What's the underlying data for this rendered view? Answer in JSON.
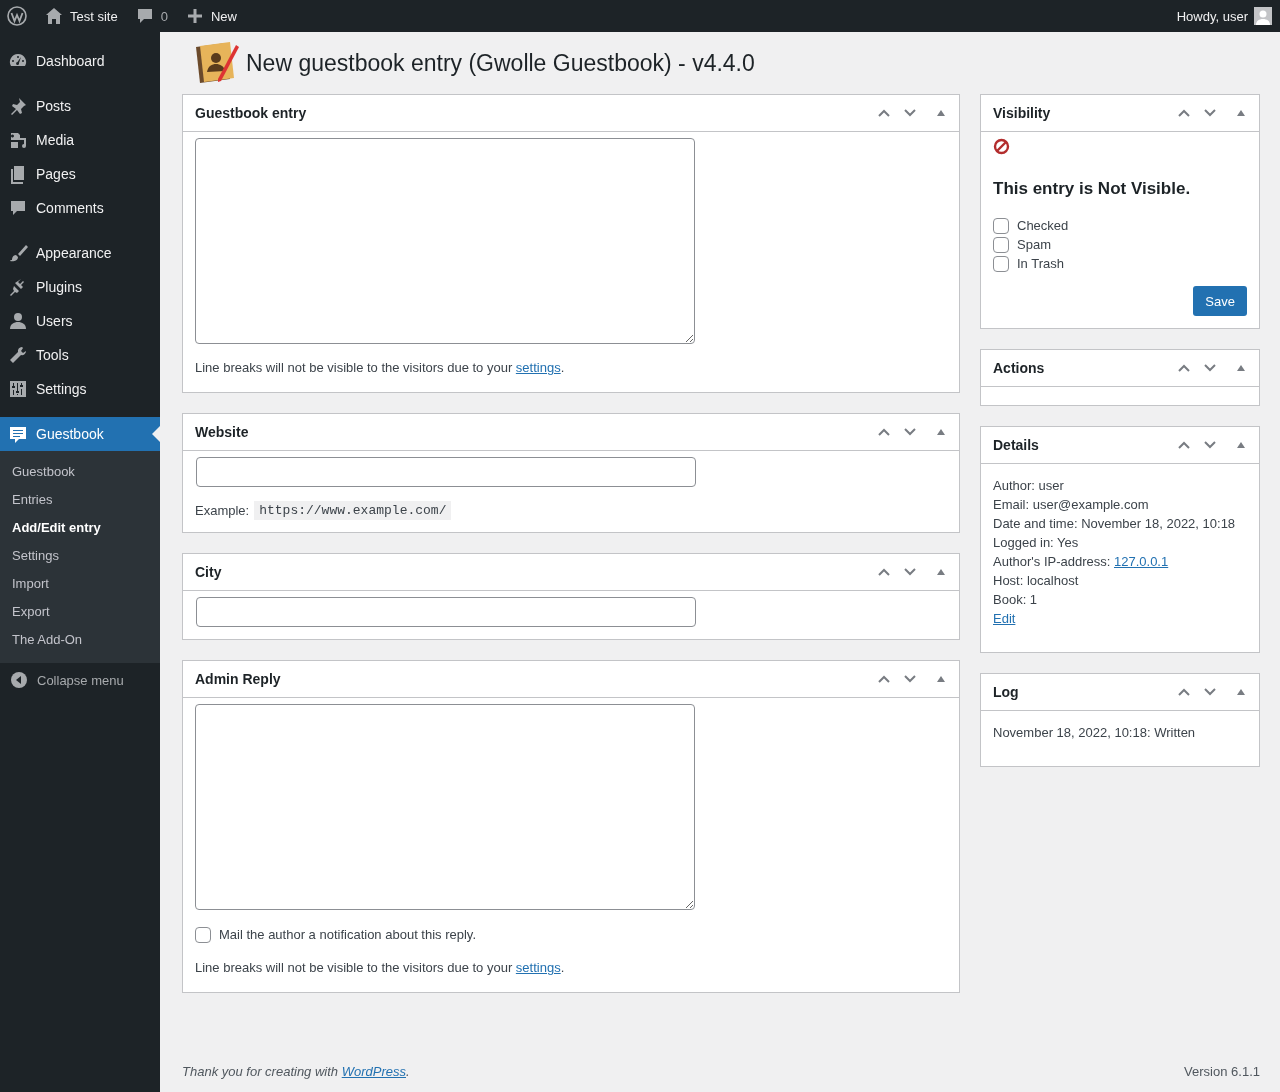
{
  "admin_bar": {
    "site": "Test site",
    "comments": "0",
    "new": "New",
    "greeting": "Howdy, user"
  },
  "menu_groups": [
    {
      "items": [
        {
          "label": "Dashboard",
          "kind": "dashboard",
          "selected": false
        }
      ]
    },
    {
      "items": [
        {
          "label": "Posts",
          "kind": "pin",
          "selected": false
        },
        {
          "label": "Media",
          "kind": "media",
          "selected": false
        },
        {
          "label": "Pages",
          "kind": "pages",
          "selected": false
        },
        {
          "label": "Comments",
          "kind": "comment",
          "selected": false
        }
      ]
    },
    {
      "items": [
        {
          "label": "Appearance",
          "kind": "brush",
          "selected": false
        },
        {
          "label": "Plugins",
          "kind": "plug",
          "selected": false
        },
        {
          "label": "Users",
          "kind": "user",
          "selected": false
        },
        {
          "label": "Tools",
          "kind": "wrench",
          "selected": false
        },
        {
          "label": "Settings",
          "kind": "sliders",
          "selected": false
        }
      ]
    },
    {
      "items": [
        {
          "label": "Guestbook",
          "kind": "guestbook",
          "selected": true,
          "submenu": [
            {
              "label": "Guestbook",
              "selected": false
            },
            {
              "label": "Entries",
              "selected": false
            },
            {
              "label": "Add/Edit entry",
              "selected": true
            },
            {
              "label": "Settings",
              "selected": false
            },
            {
              "label": "Import",
              "selected": false
            },
            {
              "label": "Export",
              "selected": false
            },
            {
              "label": "The Add-On",
              "selected": false
            }
          ]
        }
      ]
    }
  ],
  "collapse": "Collapse menu",
  "page_title": "New guestbook entry (Gwolle Guestbook) - v4.4.0",
  "main_boxes": [
    {
      "title": "Guestbook entry",
      "kind": "textarea",
      "note": {
        "text": "Line breaks will not be visible to the visitors due to your ",
        "link": "settings",
        "after": "."
      }
    },
    {
      "title": "Website",
      "kind": "input",
      "example": {
        "label": "Example:",
        "code": "https://www.example.com/"
      }
    },
    {
      "title": "City",
      "kind": "input"
    },
    {
      "title": "Admin Reply",
      "kind": "textarea",
      "checkbox": {
        "label": "Mail the author a notification about this reply.",
        "checked": false
      },
      "note": {
        "text": "Line breaks will not be visible to the visitors due to your ",
        "link": "settings",
        "after": "."
      }
    }
  ],
  "side_boxes": [
    {
      "title": "Visibility",
      "kind": "visibility",
      "visible": false,
      "heading": "This entry is Not Visible.",
      "checkboxes": [
        {
          "label": "Checked",
          "checked": false
        },
        {
          "label": "Spam",
          "checked": false
        },
        {
          "label": "In Trash",
          "checked": false
        }
      ],
      "button": "Save"
    },
    {
      "title": "Actions",
      "kind": "empty"
    },
    {
      "title": "Details",
      "kind": "lines",
      "lines": [
        {
          "text": "Author: user"
        },
        {
          "text": "Email: user@example.com"
        },
        {
          "text": "Date and time: November 18, 2022, 10:18"
        },
        {
          "text": "Logged in: Yes"
        },
        {
          "text": "Author's IP-address: ",
          "link": "127.0.0.1"
        },
        {
          "text": "Host: localhost"
        },
        {
          "text": "Book: 1"
        },
        {
          "link": "Edit"
        }
      ]
    },
    {
      "title": "Log",
      "kind": "lines",
      "lines": [
        {
          "text": "November 18, 2022, 10:18: Written"
        }
      ]
    }
  ],
  "footer": {
    "text": "Thank you for creating with ",
    "link": "WordPress",
    "after": ".",
    "version": "Version 6.1.1"
  }
}
